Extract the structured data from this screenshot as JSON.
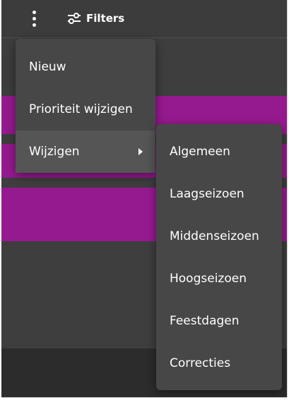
{
  "toolbar": {
    "more_icon": "vertical-dots-icon",
    "filters_icon": "sliders-icon",
    "filters_label": "Filters"
  },
  "colors": {
    "background": "#3e3e3e",
    "menu": "#474747",
    "menu_active": "#555555",
    "accent_band": "#961a8f",
    "footer": "#2c2c2c",
    "text": "#ffffff"
  },
  "main_menu": {
    "items": [
      {
        "label": "Nieuw"
      },
      {
        "label": "Prioriteit wijzigen"
      },
      {
        "label": "Wijzigen",
        "has_submenu": true,
        "active": true
      }
    ]
  },
  "sub_menu": {
    "items": [
      {
        "label": "Algemeen"
      },
      {
        "label": "Laagseizoen"
      },
      {
        "label": "Middenseizoen"
      },
      {
        "label": "Hoogseizoen"
      },
      {
        "label": "Feestdagen"
      },
      {
        "label": "Correcties"
      }
    ]
  }
}
